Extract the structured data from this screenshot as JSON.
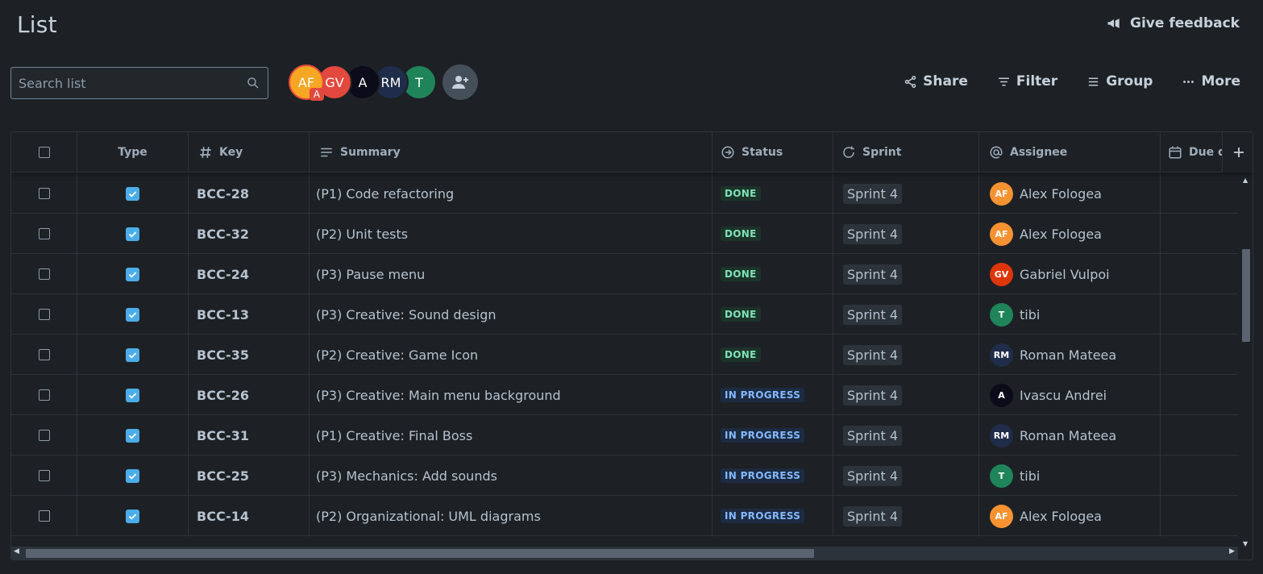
{
  "header": {
    "title": "List",
    "feedback_label": "Give feedback"
  },
  "search": {
    "placeholder": "Search list"
  },
  "avatars": [
    {
      "initials": "AF",
      "color": "#f5a623",
      "selected": true,
      "badge": "A"
    },
    {
      "initials": "GV",
      "color": "#e2483d"
    },
    {
      "initials": "A",
      "color": "#0b0b1a"
    },
    {
      "initials": "RM",
      "color": "#1f2d4a"
    },
    {
      "initials": "T",
      "color": "#1f845a"
    }
  ],
  "toolbar": {
    "share": "Share",
    "filter": "Filter",
    "group": "Group",
    "more": "More"
  },
  "columns": {
    "type": "Type",
    "key": "Key",
    "summary": "Summary",
    "status": "Status",
    "sprint": "Sprint",
    "assignee": "Assignee",
    "due": "Due d"
  },
  "rows": [
    {
      "key": "BCC-28",
      "summary": "(P1) Code refactoring",
      "status": "DONE",
      "sprint": "Sprint 4",
      "assignee": "Alex Fologea",
      "initials": "AF",
      "color": "#f79232"
    },
    {
      "key": "BCC-32",
      "summary": "(P2) Unit tests",
      "status": "DONE",
      "sprint": "Sprint 4",
      "assignee": "Alex Fologea",
      "initials": "AF",
      "color": "#f79232"
    },
    {
      "key": "BCC-24",
      "summary": "(P3) Pause menu",
      "status": "DONE",
      "sprint": "Sprint 4",
      "assignee": "Gabriel Vulpoi",
      "initials": "GV",
      "color": "#de350b"
    },
    {
      "key": "BCC-13",
      "summary": "(P3) Creative: Sound design",
      "status": "DONE",
      "sprint": "Sprint 4",
      "assignee": "tibi",
      "initials": "T",
      "color": "#1f845a"
    },
    {
      "key": "BCC-35",
      "summary": "(P2) Creative: Game Icon",
      "status": "DONE",
      "sprint": "Sprint 4",
      "assignee": "Roman Mateea",
      "initials": "RM",
      "color": "#1f2d4a"
    },
    {
      "key": "BCC-26",
      "summary": "(P3) Creative: Main menu background",
      "status": "IN PROGRESS",
      "sprint": "Sprint 4",
      "assignee": "Ivascu Andrei",
      "initials": "A",
      "color": "#0b0b1a"
    },
    {
      "key": "BCC-31",
      "summary": "(P1) Creative: Final Boss",
      "status": "IN PROGRESS",
      "sprint": "Sprint 4",
      "assignee": "Roman Mateea",
      "initials": "RM",
      "color": "#1f2d4a"
    },
    {
      "key": "BCC-25",
      "summary": "(P3) Mechanics: Add sounds",
      "status": "IN PROGRESS",
      "sprint": "Sprint 4",
      "assignee": "tibi",
      "initials": "T",
      "color": "#1f845a"
    },
    {
      "key": "BCC-14",
      "summary": "(P2) Organizational: UML diagrams",
      "status": "IN PROGRESS",
      "sprint": "Sprint 4",
      "assignee": "Alex Fologea",
      "initials": "AF",
      "color": "#f79232"
    }
  ]
}
